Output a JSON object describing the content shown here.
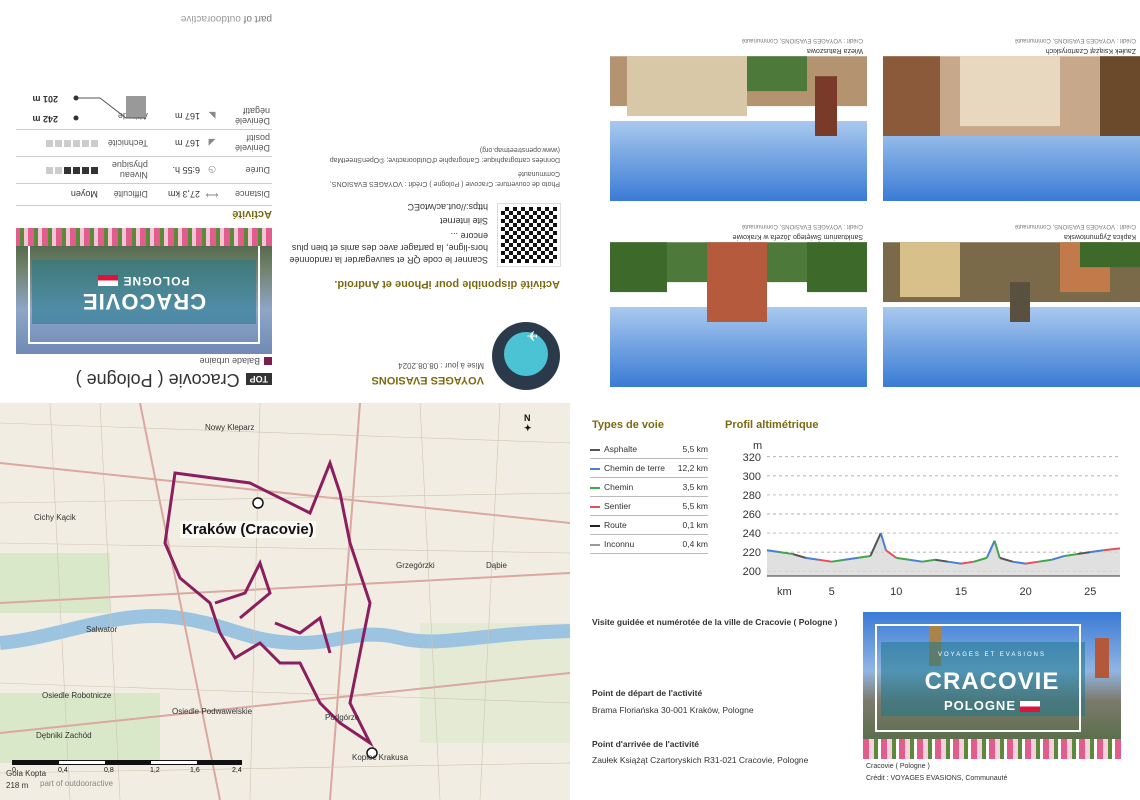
{
  "sheet": {
    "badge": "TOP",
    "title": "Cracovie ( Pologne )",
    "subtitle": "Balade urbaine",
    "cover_city": "CRACOVIE",
    "cover_country": "POLOGNE",
    "activity_heading": "Activité",
    "stats": {
      "distance_label": "Distance",
      "distance_value": "27,3 km",
      "duree_label": "Durée",
      "duree_value": "6:55 h.",
      "denivele_pos_label": "Dénivelé positif",
      "denivele_pos_value": "167 m",
      "denivele_neg_label": "Dénivelé négatif",
      "denivele_neg_value": "167 m",
      "difficulte_label": "Difficulté",
      "difficulte_value": "Moyen",
      "niveau_label": "Niveau physique",
      "niveau_dots": 4,
      "technicite_label": "Technicité",
      "technicite_dots": 0,
      "altitude_label": "Altitude",
      "alt_max": "242 m",
      "alt_min": "201 m"
    },
    "publisher": "VOYAGES EVASIONS",
    "updated": "Mise à jour : 08.08.2024",
    "app_line": "Activité disponible pour iPhone et Android.",
    "scan_text": "Scanner le code QR et sauvegarder la randonnée hors-ligne, la partager avec des amis et bien plus encore ...",
    "site_heading": "Site internet",
    "site_url": "https://out.ac/wtoEC",
    "photo_credit": "Photo de couverture: Cracovie ( Pologne ) Crédit : VOYAGES EVASIONS, Communauté",
    "carto_credit": "Données cartographique: Cartographie d'Outdooractive; ©OpenStreetMap (www.openstreetmap.org)",
    "part_of_prefix": "part of",
    "part_of_brand": "outdooractive"
  },
  "photos": [
    {
      "caption": "Wieża Ratuszowa",
      "credit": "Crédit : VOYAGES EVASIONS, Communauté"
    },
    {
      "caption": "Zaułek Książąt Czartoryskich",
      "credit": "Crédit : VOYAGES EVASIONS, Communauté"
    },
    {
      "caption": "Sanktuarium Świętego Józefa w Krakowie",
      "credit": "Crédit : VOYAGES EVASIONS, Communauté"
    },
    {
      "caption": "Kaplica Zygmuntowska",
      "credit": "Crédit : VOYAGES EVASIONS, Communauté"
    }
  ],
  "map": {
    "city_label": "Kraków (Cracovie)",
    "labels": [
      "Nowy Kleparz",
      "Cichy Kącik",
      "Salwator",
      "Osiedle Robotnicze",
      "Osiedle Podwawelskie",
      "Dębniki Zachód",
      "Podgórze",
      "Kopiec Krakusa",
      "Grzegórzki",
      "Dąbie",
      "Gola Kopta"
    ],
    "north": "N",
    "scale_ticks": [
      "0",
      "0,4",
      "0,8",
      "1,2",
      "1,6",
      "2,4"
    ],
    "corner_alt": "218 m",
    "corner_brand": "part of outdooractive"
  },
  "voie": {
    "heading": "Types de voie",
    "rows": [
      {
        "name": "Asphalte",
        "km": "5,5 km",
        "color": "#555555"
      },
      {
        "name": "Chemin de terre",
        "km": "12,2 km",
        "color": "#4a7fd1"
      },
      {
        "name": "Chemin",
        "km": "3,5 km",
        "color": "#3fa64a"
      },
      {
        "name": "Sentier",
        "km": "5,5 km",
        "color": "#e0525a"
      },
      {
        "name": "Route",
        "km": "0,1 km",
        "color": "#222222"
      },
      {
        "name": "Inconnu",
        "km": "0,4 km",
        "color": "#999999"
      }
    ]
  },
  "profile": {
    "heading": "Profil altimétrique",
    "y_unit": "m",
    "x_unit": "km"
  },
  "chart_data": {
    "type": "line",
    "title": "Profil altimétrique",
    "xlabel": "km",
    "ylabel": "m",
    "x_ticks": [
      5,
      10,
      15,
      20,
      25
    ],
    "y_ticks": [
      200,
      220,
      240,
      260,
      280,
      300,
      320
    ],
    "ylim": [
      195,
      325
    ],
    "xlim": [
      0,
      27.3
    ],
    "grid": true,
    "x": [
      0,
      1,
      2,
      3,
      4,
      5,
      6,
      7,
      8,
      8.8,
      9.2,
      10,
      11,
      12,
      13,
      14,
      15,
      16,
      17,
      17.6,
      18,
      19,
      20,
      21,
      22,
      23,
      24,
      25,
      26,
      27.3
    ],
    "y": [
      222,
      220,
      218,
      214,
      212,
      210,
      212,
      214,
      216,
      240,
      222,
      214,
      212,
      210,
      212,
      210,
      208,
      210,
      214,
      232,
      214,
      210,
      208,
      210,
      212,
      216,
      218,
      220,
      222,
      224
    ]
  },
  "info": {
    "title": "Visite guidée et numérotée de la ville de Cracovie ( Pologne )",
    "start_heading": "Point de départ de l'activité",
    "start_value": "Brama Floriańska 30-001 Kraków, Pologne",
    "end_heading": "Point d'arrivée de l'activité",
    "end_value": "Zaułek Książąt Czartoryskich  R31-021 Cracovie, Pologne",
    "cover_tiny": "VOYAGES ET EVASIONS",
    "cover_city": "CRACOVIE",
    "cover_country": "POLOGNE",
    "cover_caption": "Cracovie ( Pologne )",
    "cover_credit": "Crédit : VOYAGES EVASIONS, Communauté"
  }
}
